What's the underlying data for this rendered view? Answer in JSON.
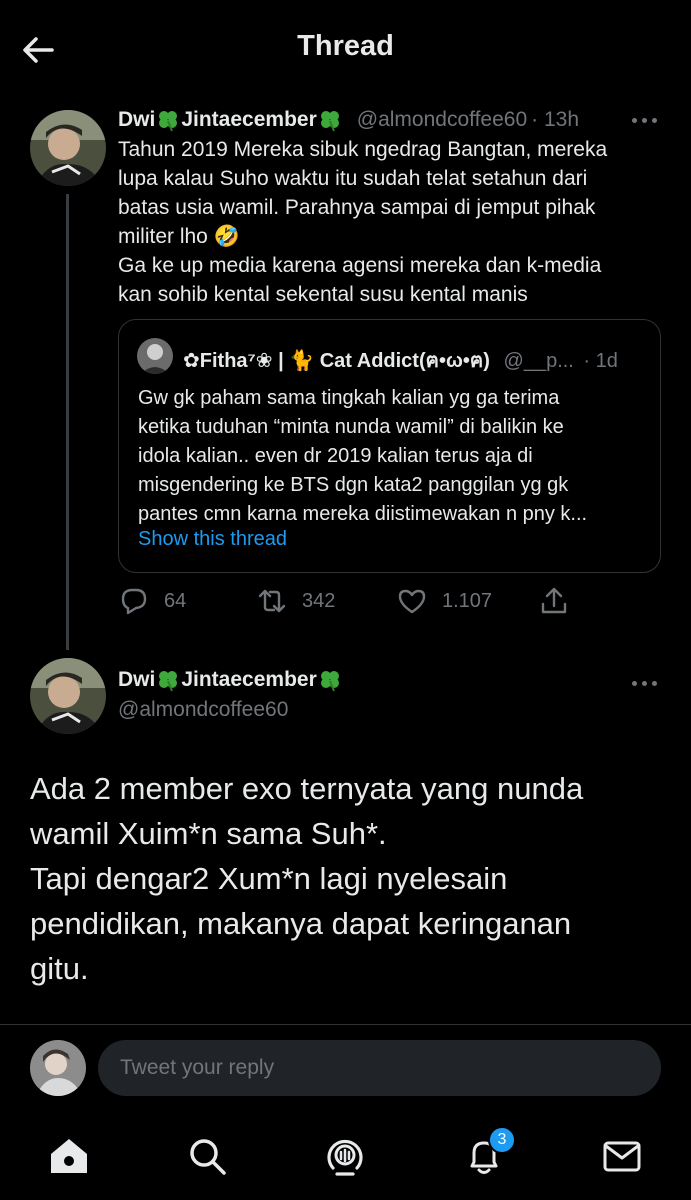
{
  "header": {
    "title": "Thread",
    "back_icon": "arrow-left-icon"
  },
  "tweet1": {
    "display_name": "Dwi",
    "display_name_suffix": "Jintaecember",
    "name_emoji": "four-leaf-clover",
    "handle": "@almondcoffee60",
    "time": "· 13h",
    "text": "Tahun 2019 Mereka sibuk ngedrag Bangtan, mereka\nlupa kalau Suho waktu itu sudah telat setahun dari\nbatas usia wamil. Parahnya sampai di jemput pihak\nmiliter lho 🤣\nGa ke up media karena agensi mereka dan k-media\nkan sohib kental sekental susu kental manis",
    "quote": {
      "name": "✿Fitha⁷❀ | 🐈 Cat Addict(ฅ•ω•ฅ)",
      "handle": "@__p...",
      "time": "· 1d",
      "text": "Gw gk paham sama tingkah kalian yg ga terima\nketika tuduhan “minta nunda wamil” di balikin ke\nidola kalian.. even dr 2019 kalian terus aja di\nmisgendering ke BTS dgn kata2 panggilan yg gk\npantes cmn karna mereka diistimewakan n pny k...",
      "show_thread": "Show this thread"
    },
    "actions": {
      "replies": "64",
      "retweets": "342",
      "likes": "1.107"
    }
  },
  "tweet2": {
    "display_name": "Dwi",
    "display_name_suffix": "Jintaecember",
    "handle": "@almondcoffee60",
    "text": "Ada 2 member exo ternyata yang nunda\nwamil Xuim*n sama Suh*.\nTapi dengar2 Xum*n lagi nyelesain\npendidikan, makanya dapat keringanan\ngitu."
  },
  "reply": {
    "placeholder": "Tweet your reply"
  },
  "nav": {
    "items": [
      "home-icon",
      "search-icon",
      "spaces-icon",
      "notifications-icon",
      "messages-icon"
    ],
    "notification_count": "3"
  },
  "colors": {
    "background": "#000000",
    "text": "#e7e9ea",
    "muted": "#71767b",
    "accent": "#1d9bf0",
    "border": "#2f3336"
  }
}
